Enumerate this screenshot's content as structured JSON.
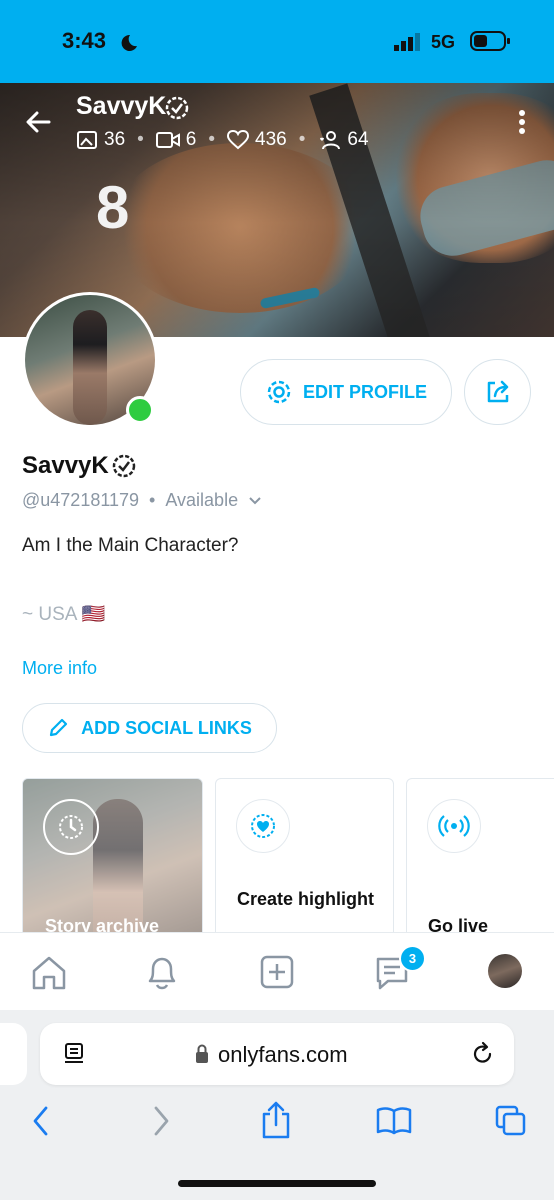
{
  "status_bar": {
    "time": "3:43",
    "network": "5G"
  },
  "header": {
    "name": "SavvyK",
    "stats": {
      "photos": "36",
      "videos": "6",
      "likes": "436",
      "fans": "64"
    }
  },
  "cover": {
    "decor_text": "8"
  },
  "profile": {
    "edit_label": "EDIT PROFILE",
    "display_name": "SavvyK",
    "handle": "@u472181179",
    "status": "Available",
    "bio": "Am I the Main Character?",
    "location": "~ USA 🇺🇸",
    "more_info": "More info",
    "social_label": "ADD SOCIAL LINKS"
  },
  "cards": [
    {
      "label": "Story archive"
    },
    {
      "label": "Create highlight"
    },
    {
      "label": "Go live"
    }
  ],
  "bottom_nav": {
    "messages_badge": "3"
  },
  "browser": {
    "url": "onlyfans.com"
  },
  "colors": {
    "brand": "#00aff0",
    "online": "#2ecc40"
  }
}
